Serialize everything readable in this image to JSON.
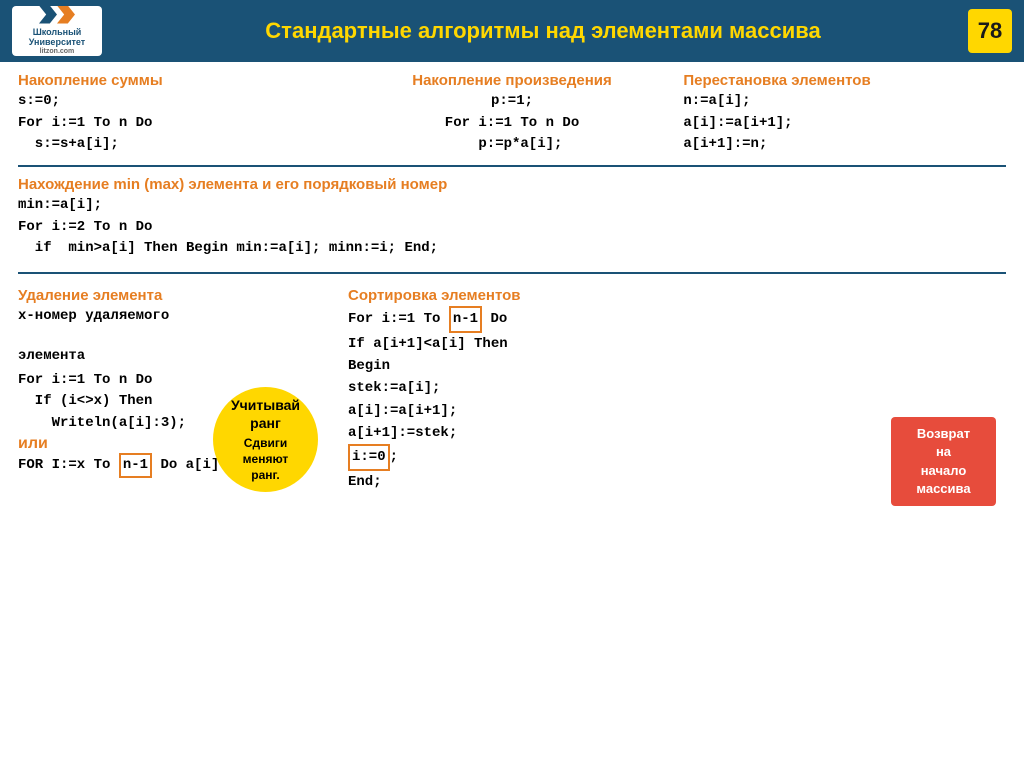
{
  "header": {
    "logo_line1": "Школьный",
    "logo_line2": "Университет",
    "logo_line3": "litzon.com",
    "title": "Стандартные алгоритмы над элементами массива",
    "page_number": "78"
  },
  "section1": {
    "title": "Накопление суммы",
    "code": "s:=0;\nFor i:=1 To n Do\n  s:=s+a[i];"
  },
  "section2": {
    "title": "Накопление произведения",
    "code": "p:=1;\nFor i:=1 To n Do\n  p:=p*a[i];"
  },
  "section3": {
    "title": "Перестановка элементов",
    "code": "n:=a[i];\na[i]:=a[i+1];\na[i+1]:=n;"
  },
  "section_min": {
    "title": "Нахождение  min (max) элемента и его порядковый номер",
    "code": "min:=a[i];\nFor i:=2 To n Do\n  if  min>a[i] Then Begin min:=a[i]; minn:=i; End;"
  },
  "section_delete": {
    "title": "Удаление элемента",
    "line1": "x-номер  удаляемого",
    "line2": "элемента",
    "code1": "For i:=1 To n Do\n  If (i<>x) Then\n    Writeln(a[i]:3);",
    "ili": "или",
    "code2": "FOR I:=x To ",
    "highlight": "n-1",
    "code2b": " Do\n  a[i]:=a[i+1];"
  },
  "section_sort": {
    "title": "Сортировка элементов",
    "line1": "For i:=1 To ",
    "highlight1": "n-1",
    "line1b": " Do",
    "line2": "  If a[i+1]<a[i] Then",
    "line3": "  Begin",
    "line4": "    stek:=a[i];",
    "line5": "    a[i]:=a[i+1];",
    "line6": "    a[i+1]:=stek;",
    "highlight2_prefix": "    ",
    "highlight2": "i:=0",
    "highlight2_suffix": ";",
    "line7": "  End;"
  },
  "balloon_rank": {
    "line1": "Учитывай",
    "line2": "ранг",
    "line3": "Сдвиги",
    "line4": "меняют",
    "line5": "ранг."
  },
  "balloon_return": {
    "line1": "Возврат",
    "line2": "на",
    "line3": "начало",
    "line4": "массива"
  }
}
